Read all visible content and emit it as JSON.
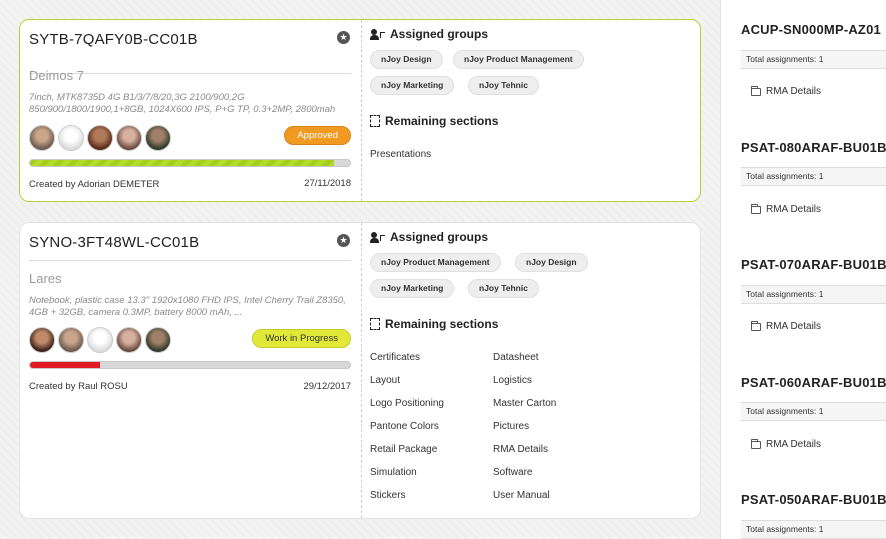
{
  "cards": [
    {
      "code": "SYTB-7QAFY0B-CC01B",
      "name": "Deimos 7",
      "description": "7inch, MTK8735D 4G B1/3/7/8/20,3G 2100/900,2G 850/900/1800/1900,1+8GB, 1024X600 IPS, P+G TP, 0.3+2MP, 2800mah",
      "status": "Approved",
      "progress": 0.95,
      "created_by": "Created by Adorian DEMETER",
      "date": "27/11/2018",
      "groups_title": "Assigned groups",
      "groups": [
        "nJoy Design",
        "nJoy Product Management",
        "nJoy Marketing",
        "nJoy Tehnic"
      ],
      "sections_title": "Remaining sections",
      "sections": [
        "Presentations"
      ],
      "avatars": [
        "#6b5a4e",
        "#e8e8e8",
        "#7a3a2a",
        "#8a5a50",
        "#3f4a3a"
      ]
    },
    {
      "code": "SYNO-3FT48WL-CC01B",
      "name": "Lares",
      "description": "Notebook, plastic case 13.3\" 1920x1080 FHD IPS, Intel Cherry Trail Z8350, 4GB + 32GB, camera 0.3MP, battery 8000 mAh, ...",
      "status": "Work in Progress",
      "progress": 0.22,
      "created_by": "Created by Raul ROSU",
      "date": "29/12/2017",
      "groups_title": "Assigned groups",
      "groups": [
        "nJoy Product Management",
        "nJoy Design",
        "nJoy Marketing",
        "nJoy Tehnic"
      ],
      "sections_title": "Remaining sections",
      "sections_col1": [
        "Certificates",
        "Layout",
        "Logo Positioning",
        "Pantone Colors",
        "Retail Package",
        "Simulation",
        "Stickers"
      ],
      "sections_col2": [
        "Datasheet",
        "Logistics",
        "Master Carton",
        "Pictures",
        "RMA Details",
        "Software",
        "User Manual"
      ],
      "avatars": [
        "#5a3a2a",
        "#6b5a4e",
        "#e8e8e8",
        "#8a5a50",
        "#3f4a3a"
      ]
    }
  ],
  "side_items": [
    {
      "code": "ACUP-SN000MP-AZ01",
      "assignments": "Total assignments: 1",
      "link": "RMA Details"
    },
    {
      "code": "PSAT-080ARAF-BU01B",
      "assignments": "Total assignments: 1",
      "link": "RMA Details"
    },
    {
      "code": "PSAT-070ARAF-BU01B",
      "assignments": "Total assignments: 1",
      "link": "RMA Details"
    },
    {
      "code": "PSAT-060ARAF-BU01B",
      "assignments": "Total assignments: 1",
      "link": "RMA Details"
    },
    {
      "code": "PSAT-050ARAF-BU01B",
      "assignments": "Total assignments: 1",
      "link": ""
    }
  ],
  "colors": {
    "approved": "#f19a22",
    "wip": "#e1e838",
    "progress_green": "#a3cf1c",
    "progress_red": "#e01b24",
    "selected_border": "#b4d433"
  },
  "icons": {
    "star": "star-icon",
    "group": "assigned-groups-icon",
    "sections": "remaining-sections-icon",
    "folder": "folder-icon"
  }
}
